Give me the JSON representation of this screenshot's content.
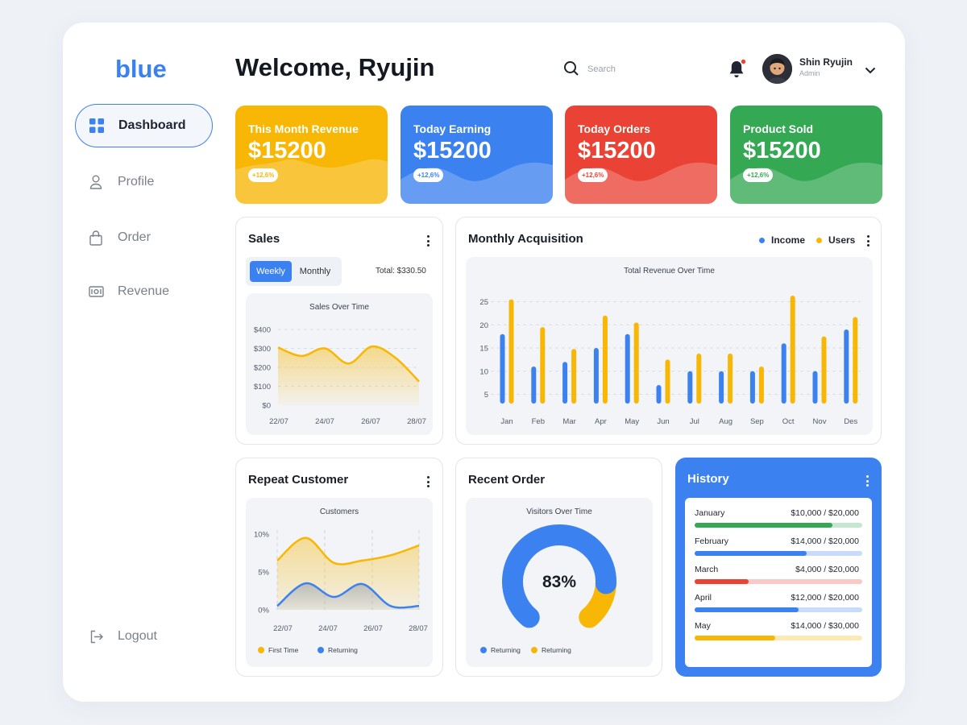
{
  "brand": {
    "logo": "blue",
    "accent": "#3b82f0"
  },
  "sidebar": {
    "items": [
      {
        "label": "Dashboard",
        "icon": "grid-icon",
        "active": true
      },
      {
        "label": "Profile",
        "icon": "user-icon"
      },
      {
        "label": "Order",
        "icon": "bag-icon"
      },
      {
        "label": "Revenue",
        "icon": "cash-icon"
      }
    ],
    "logout": "Logout"
  },
  "header": {
    "welcome": "Welcome, Ryujin",
    "search_placeholder": "Search",
    "user_name": "Shin Ryujin",
    "user_role": "Admin"
  },
  "stats": [
    {
      "title": "This Month Revenue",
      "value": "$15200",
      "badge": "+12,6%",
      "color": "#f8b704"
    },
    {
      "title": "Today Earning",
      "value": "$15200",
      "badge": "+12,6%",
      "color": "#3b82f0"
    },
    {
      "title": "Today Orders",
      "value": "$15200",
      "badge": "+12,6%",
      "color": "#ea4335"
    },
    {
      "title": "Product Sold",
      "value": "$15200",
      "badge": "+12,6%",
      "color": "#34a853"
    }
  ],
  "sales": {
    "title": "Sales",
    "tab_weekly": "Weekly",
    "tab_monthly": "Monthly",
    "total": "Total: $330.50"
  },
  "acquisition": {
    "title": "Monthly Acquisition",
    "legend_income": "Income",
    "legend_users": "Users"
  },
  "repeat": {
    "title": "Repeat Customer"
  },
  "recent": {
    "title": "Recent Order",
    "percent": "83%"
  },
  "history": {
    "title": "History",
    "rows": [
      {
        "month": "January",
        "value": "$10,000 / $20,000",
        "fill": 0.82,
        "color": "#34a853",
        "track": "#c6e7cf"
      },
      {
        "month": "February",
        "value": "$14,000 / $20,000",
        "fill": 0.67,
        "color": "#3b82f0",
        "track": "#c8dbfb"
      },
      {
        "month": "March",
        "value": "$4,000 / $20,000",
        "fill": 0.32,
        "color": "#ea4335",
        "track": "#f8c9c5"
      },
      {
        "month": "April",
        "value": "$12,000 / $20,000",
        "fill": 0.62,
        "color": "#3b82f0",
        "track": "#c8dbfb"
      },
      {
        "month": "May",
        "value": "$14,000 / $30,000",
        "fill": 0.48,
        "color": "#f8b704",
        "track": "#fde9b3"
      }
    ]
  },
  "colors": {
    "yellow": "#f8b704",
    "blue": "#3b82f0",
    "red": "#ea4335",
    "green": "#34a853"
  },
  "chart_data": [
    {
      "type": "area",
      "title": "Sales Over Time",
      "x": [
        "22/07",
        "24/07",
        "26/07",
        "28/07"
      ],
      "yticks": [
        "$0",
        "$100",
        "$200",
        "$300",
        "$400"
      ],
      "ylim": [
        0,
        400
      ],
      "series": [
        {
          "values": [
            305,
            260,
            300,
            220,
            310,
            250,
            125
          ]
        }
      ]
    },
    {
      "type": "bar",
      "title": "Total Revenue Over Time",
      "categories": [
        "Jan",
        "Feb",
        "Mar",
        "Apr",
        "May",
        "Jun",
        "Jul",
        "Aug",
        "Sep",
        "Oct",
        "Nov",
        "Des"
      ],
      "yticks": [
        "5",
        "10",
        "15",
        "20",
        "25"
      ],
      "ylim": [
        3,
        27
      ],
      "series": [
        {
          "name": "Income",
          "values": [
            18,
            11,
            12,
            15,
            18,
            7,
            10,
            10,
            10,
            16,
            10,
            19
          ]
        },
        {
          "name": "Users",
          "values": [
            25.5,
            19.5,
            14.8,
            22,
            20.5,
            12.5,
            13.8,
            13.8,
            11,
            26.3,
            17.5,
            21.7
          ]
        }
      ]
    },
    {
      "type": "area",
      "title": "Customers",
      "x": [
        "22/07",
        "24/07",
        "26/07",
        "28/07"
      ],
      "yticks": [
        "0%",
        "5%",
        "10%"
      ],
      "ylim": [
        0,
        10
      ],
      "series": [
        {
          "name": "First Time",
          "values": [
            6.5,
            9.5,
            6.2,
            6.5,
            7.2,
            8.5
          ]
        },
        {
          "name": "Returning",
          "values": [
            0.5,
            3.5,
            1.7,
            3.4,
            0.5,
            0.5
          ]
        }
      ]
    },
    {
      "type": "pie",
      "title": "Visitors Over Time",
      "series": [
        {
          "name": "Returning",
          "value": 83
        },
        {
          "name": "Returning",
          "value": 17
        }
      ]
    }
  ]
}
